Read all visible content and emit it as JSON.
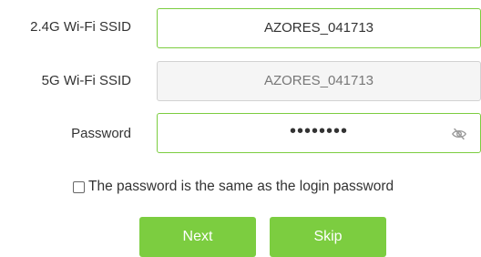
{
  "form": {
    "ssid_24": {
      "label": "2.4G Wi-Fi SSID",
      "value": "AZORES_041713"
    },
    "ssid_5": {
      "label": "5G Wi-Fi SSID",
      "value": "AZORES_041713"
    },
    "password": {
      "label": "Password",
      "masked_value": "••••••••",
      "toggle_icon": "eye-slash-icon"
    },
    "same_password_checkbox": {
      "label": "The password is the same as the login password",
      "checked": false
    }
  },
  "buttons": {
    "next_label": "Next",
    "skip_label": "Skip"
  },
  "colors": {
    "accent": "#7ccd40",
    "disabled_border": "#d2d2d2",
    "disabled_bg": "#f5f5f5"
  }
}
